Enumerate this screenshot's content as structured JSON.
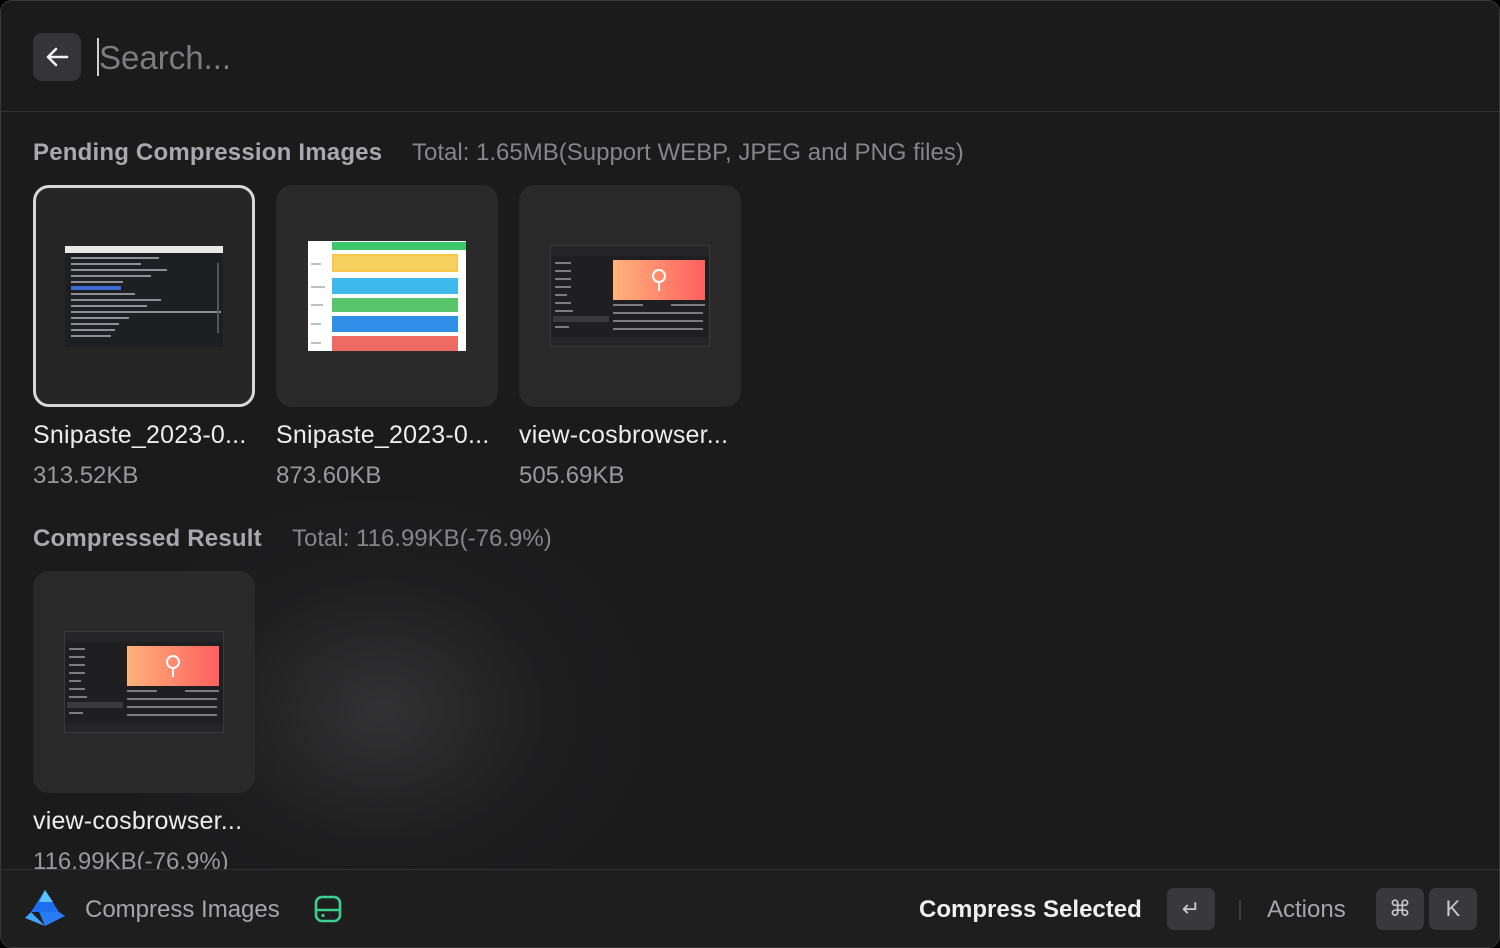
{
  "search": {
    "placeholder": "Search..."
  },
  "pending": {
    "title": "Pending Compression Images",
    "total": "Total: 1.65MB(Support WEBP, JPEG and PNG files)",
    "items": [
      {
        "name": "Snipaste_2023-0...",
        "size": "313.52KB",
        "selected": true
      },
      {
        "name": "Snipaste_2023-0...",
        "size": "873.60KB",
        "selected": false
      },
      {
        "name": "view-cosbrowser...",
        "size": "505.69KB",
        "selected": false
      }
    ]
  },
  "compressed": {
    "title": "Compressed Result",
    "total": "Total: 116.99KB(-76.9%)",
    "items": [
      {
        "name": "view-cosbrowser...",
        "size": "116.99KB(-76.9%)"
      }
    ]
  },
  "footer": {
    "app_name": "Compress Images",
    "primary_action": "Compress Selected",
    "primary_key": "↵",
    "actions_label": "Actions",
    "actions_keys": [
      "⌘",
      "K"
    ]
  },
  "colors": {
    "background": "#1b1b1c",
    "card": "#2a2a2b",
    "accent_green": "#3ecf8e",
    "app_icon_blue": "#2a7cf6"
  }
}
